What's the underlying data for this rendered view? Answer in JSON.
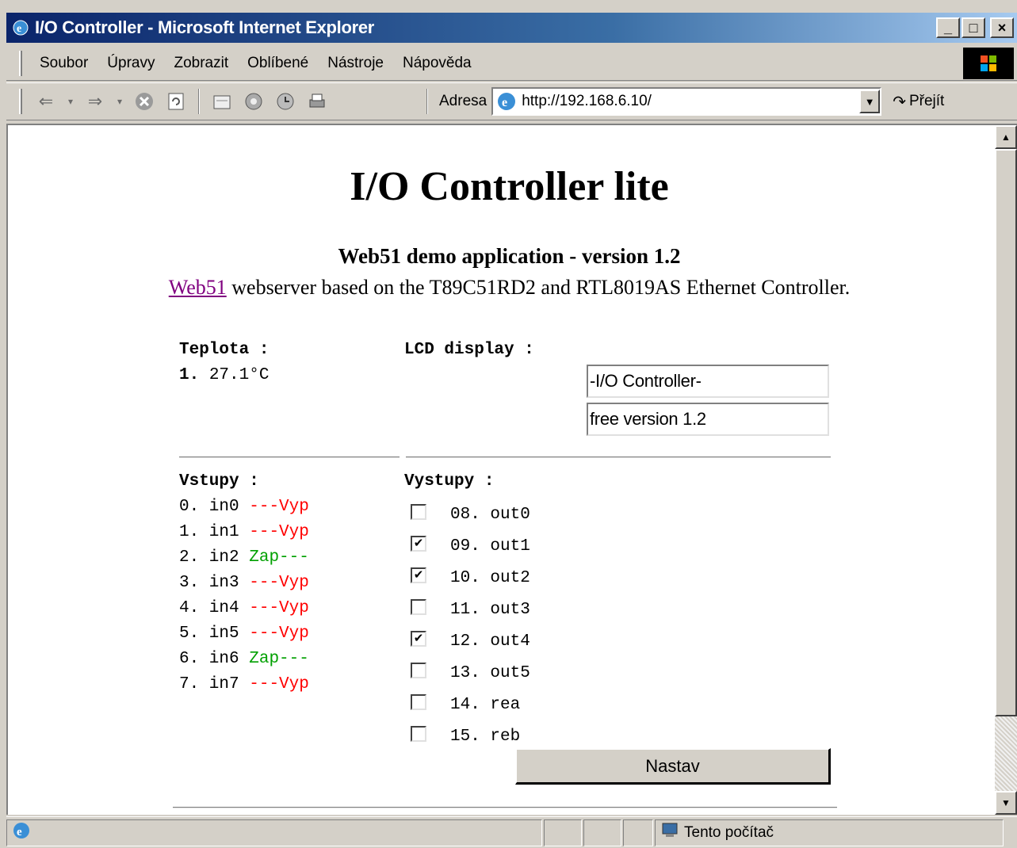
{
  "window": {
    "title": "I/O Controller - Microsoft Internet Explorer",
    "minimize": "_",
    "maximize": "□",
    "close": "×"
  },
  "menu": {
    "items": [
      "Soubor",
      "Úpravy",
      "Zobrazit",
      "Oblíbené",
      "Nástroje",
      "Nápověda"
    ]
  },
  "toolbar": {
    "address_label": "Adresa",
    "url": "http://192.168.6.10/",
    "go_label": "Přejít",
    "icons": [
      "back-icon",
      "forward-icon",
      "stop-icon",
      "refresh-icon",
      "home-icon",
      "search-icon",
      "history-icon",
      "print-icon"
    ]
  },
  "page": {
    "title": "I/O Controller lite",
    "subtitle": "Web51 demo application - version 1.2",
    "desc_link": "Web51",
    "desc_rest": " webserver based on the T89C51RD2 and RTL8019AS Ethernet Controller.",
    "temperature": {
      "heading": "Teplota :",
      "index": "1.",
      "value": "27.1°C"
    },
    "lcd": {
      "heading": "LCD display :",
      "line1": "-I/O Controller-",
      "line2": "free version 1.2"
    },
    "inputs": {
      "heading": "Vstupy :",
      "items": [
        {
          "label": "0. in0",
          "state": "---Vyp",
          "color": "#ff0000"
        },
        {
          "label": "1. in1",
          "state": "---Vyp",
          "color": "#ff0000"
        },
        {
          "label": "2. in2",
          "state": "Zap---",
          "color": "#00a000"
        },
        {
          "label": "3. in3",
          "state": "---Vyp",
          "color": "#ff0000"
        },
        {
          "label": "4. in4",
          "state": "---Vyp",
          "color": "#ff0000"
        },
        {
          "label": "5. in5",
          "state": "---Vyp",
          "color": "#ff0000"
        },
        {
          "label": "6. in6",
          "state": "Zap---",
          "color": "#00a000"
        },
        {
          "label": "7. in7",
          "state": "---Vyp",
          "color": "#ff0000"
        }
      ]
    },
    "outputs": {
      "heading": "Vystupy :",
      "items": [
        {
          "label": "08. out0",
          "checked": false
        },
        {
          "label": "09. out1",
          "checked": true
        },
        {
          "label": "10. out2",
          "checked": true
        },
        {
          "label": "11. out3",
          "checked": false
        },
        {
          "label": "12. out4",
          "checked": true
        },
        {
          "label": "13. out5",
          "checked": false
        },
        {
          "label": "14. rea",
          "checked": false
        },
        {
          "label": "15. reb",
          "checked": false
        }
      ]
    },
    "submit_label": "Nastav"
  },
  "status": {
    "zone": "Tento počítač"
  }
}
